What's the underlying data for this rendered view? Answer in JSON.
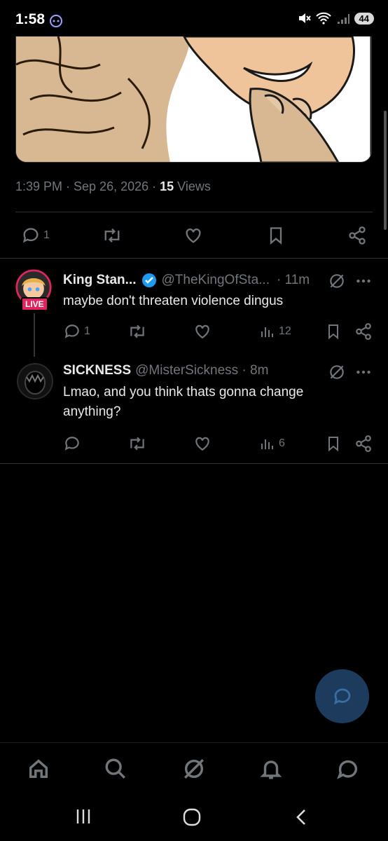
{
  "status": {
    "time": "1:58",
    "battery": "44"
  },
  "tweet": {
    "time_label": "1:39 PM · Sep 26, 2026 · ",
    "views_count": "15",
    "views_label": " Views",
    "reply_count": "1"
  },
  "replies": [
    {
      "name": "King Stan...",
      "handle": "@TheKingOfSta...",
      "time": "· 11m",
      "live_label": "LIVE",
      "text": "maybe don't threaten violence dingus",
      "reply_count": "1",
      "views": "12"
    },
    {
      "name": "SICKNESS",
      "handle": "@MisterSickness · 8m",
      "text_line1": "Lmao, and you think thats gonna change",
      "text_line2": "anything?",
      "views": "6"
    }
  ],
  "colors": {
    "accent": "#1d9bf0",
    "live": "#e0245e",
    "muted": "#71767b"
  },
  "icons": [
    "comment-icon",
    "retweet-icon",
    "heart-icon",
    "bookmark-icon",
    "share-icon",
    "views-icon",
    "grok-icon",
    "more-icon",
    "verified-icon",
    "home-icon",
    "search-icon",
    "bell-icon",
    "messages-icon"
  ]
}
